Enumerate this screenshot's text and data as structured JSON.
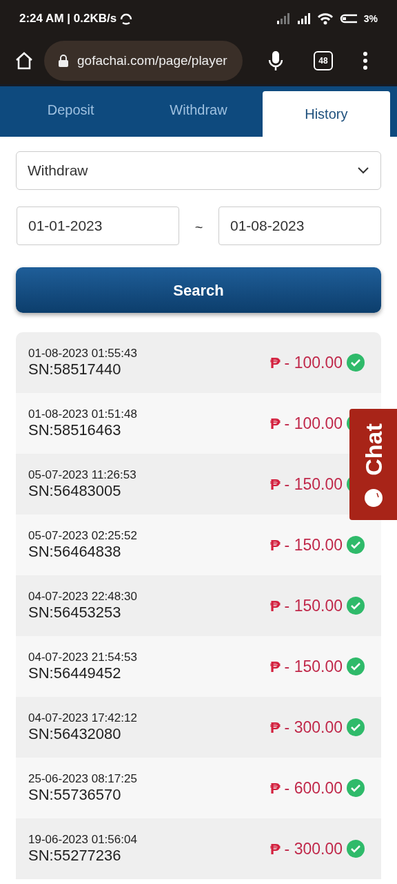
{
  "status_bar": {
    "time": "2:24 AM | 0.2KB/s",
    "battery": "3%"
  },
  "browser": {
    "url": "gofachai.com/page/player",
    "tab_count": "48"
  },
  "tabs": [
    {
      "label": "Deposit",
      "selected": false
    },
    {
      "label": "Withdraw",
      "selected": false
    },
    {
      "label": "History",
      "selected": true
    }
  ],
  "type_select": {
    "value": "Withdraw"
  },
  "date_range": {
    "from": "01-01-2023",
    "separator": "~",
    "to": "01-08-2023"
  },
  "search_button": "Search",
  "records": [
    {
      "datetime": "01-08-2023 01:55:43",
      "sn": "SN:58517440",
      "currency": "₱",
      "amount": "- 100.00",
      "completed": true
    },
    {
      "datetime": "01-08-2023 01:51:48",
      "sn": "SN:58516463",
      "currency": "₱",
      "amount": "- 100.00",
      "completed": true
    },
    {
      "datetime": "05-07-2023 11:26:53",
      "sn": "SN:56483005",
      "currency": "₱",
      "amount": "- 150.00",
      "completed": true
    },
    {
      "datetime": "05-07-2023 02:25:52",
      "sn": "SN:56464838",
      "currency": "₱",
      "amount": "- 150.00",
      "completed": true
    },
    {
      "datetime": "04-07-2023 22:48:30",
      "sn": "SN:56453253",
      "currency": "₱",
      "amount": "- 150.00",
      "completed": true
    },
    {
      "datetime": "04-07-2023 21:54:53",
      "sn": "SN:56449452",
      "currency": "₱",
      "amount": "- 150.00",
      "completed": true
    },
    {
      "datetime": "04-07-2023 17:42:12",
      "sn": "SN:56432080",
      "currency": "₱",
      "amount": "- 300.00",
      "completed": true
    },
    {
      "datetime": "25-06-2023 08:17:25",
      "sn": "SN:55736570",
      "currency": "₱",
      "amount": "- 600.00",
      "completed": true
    },
    {
      "datetime": "19-06-2023 01:56:04",
      "sn": "SN:55277236",
      "currency": "₱",
      "amount": "- 300.00",
      "completed": true
    }
  ],
  "chat_button": "Chat"
}
